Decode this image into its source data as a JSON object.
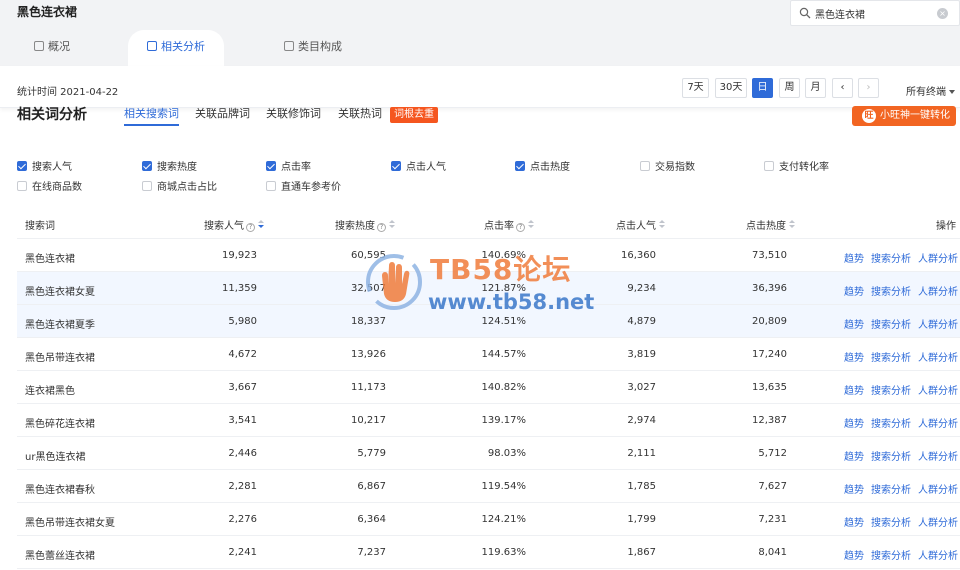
{
  "header": {
    "title": "黑色连衣裙",
    "search_value": "黑色连衣裙"
  },
  "main_tabs": [
    {
      "label": "概况"
    },
    {
      "label": "相关分析"
    },
    {
      "label": "类目构成"
    }
  ],
  "datebar": {
    "stat_time": "统计时间 2021-04-22",
    "buttons": [
      "7天",
      "30天",
      "日",
      "周",
      "月"
    ],
    "active_button": "日",
    "prev": "‹",
    "next": "›",
    "terminal": "所有终端"
  },
  "section": {
    "title": "相关词分析",
    "sub_tabs": [
      "相关搜索词",
      "关联品牌词",
      "关联修饰词",
      "关联热词"
    ],
    "dedup_badge": "词根去重",
    "convert_button": "小旺神一键转化",
    "convert_icon": "旺"
  },
  "metrics": [
    {
      "label": "搜索人气",
      "checked": true
    },
    {
      "label": "搜索热度",
      "checked": true
    },
    {
      "label": "点击率",
      "checked": true
    },
    {
      "label": "点击人气",
      "checked": true
    },
    {
      "label": "点击热度",
      "checked": true
    },
    {
      "label": "交易指数",
      "checked": false
    },
    {
      "label": "支付转化率",
      "checked": false
    },
    {
      "label": "在线商品数",
      "checked": false
    },
    {
      "label": "商城点击占比",
      "checked": false
    },
    {
      "label": "直通车参考价",
      "checked": false
    }
  ],
  "table": {
    "columns": [
      "搜索词",
      "搜索人气",
      "搜索热度",
      "点击率",
      "点击人气",
      "点击热度",
      "操作"
    ],
    "actions": [
      "趋势",
      "搜索分析",
      "人群分析"
    ],
    "rows": [
      {
        "term": "黑色连衣裙",
        "search_popularity": "19,923",
        "search_heat": "60,595",
        "ctr": "140.69%",
        "click_popularity": "16,360",
        "click_heat": "73,510"
      },
      {
        "term": "黑色连衣裙女夏",
        "search_popularity": "11,359",
        "search_heat": "32,507",
        "ctr": "121.87%",
        "click_popularity": "9,234",
        "click_heat": "36,396"
      },
      {
        "term": "黑色连衣裙夏季",
        "search_popularity": "5,980",
        "search_heat": "18,337",
        "ctr": "124.51%",
        "click_popularity": "4,879",
        "click_heat": "20,809"
      },
      {
        "term": "黑色吊带连衣裙",
        "search_popularity": "4,672",
        "search_heat": "13,926",
        "ctr": "144.57%",
        "click_popularity": "3,819",
        "click_heat": "17,240"
      },
      {
        "term": "连衣裙黑色",
        "search_popularity": "3,667",
        "search_heat": "11,173",
        "ctr": "140.82%",
        "click_popularity": "3,027",
        "click_heat": "13,635"
      },
      {
        "term": "黑色碎花连衣裙",
        "search_popularity": "3,541",
        "search_heat": "10,217",
        "ctr": "139.17%",
        "click_popularity": "2,974",
        "click_heat": "12,387"
      },
      {
        "term": "ur黑色连衣裙",
        "search_popularity": "2,446",
        "search_heat": "5,779",
        "ctr": "98.03%",
        "click_popularity": "2,111",
        "click_heat": "5,712"
      },
      {
        "term": "黑色连衣裙春秋",
        "search_popularity": "2,281",
        "search_heat": "6,867",
        "ctr": "119.54%",
        "click_popularity": "1,785",
        "click_heat": "7,627"
      },
      {
        "term": "黑色吊带连衣裙女夏",
        "search_popularity": "2,276",
        "search_heat": "6,364",
        "ctr": "124.21%",
        "click_popularity": "1,799",
        "click_heat": "7,231"
      },
      {
        "term": "黑色蕾丝连衣裙",
        "search_popularity": "2,241",
        "search_heat": "7,237",
        "ctr": "119.63%",
        "click_popularity": "1,867",
        "click_heat": "8,041"
      }
    ]
  },
  "watermark": {
    "line1": "TB58论坛",
    "line2": "www.tb58.net"
  },
  "colors": {
    "accent": "#2f6bd8",
    "orange": "#f26522",
    "badge": "#f5561f",
    "row_highlight": "#f2f7ff"
  }
}
